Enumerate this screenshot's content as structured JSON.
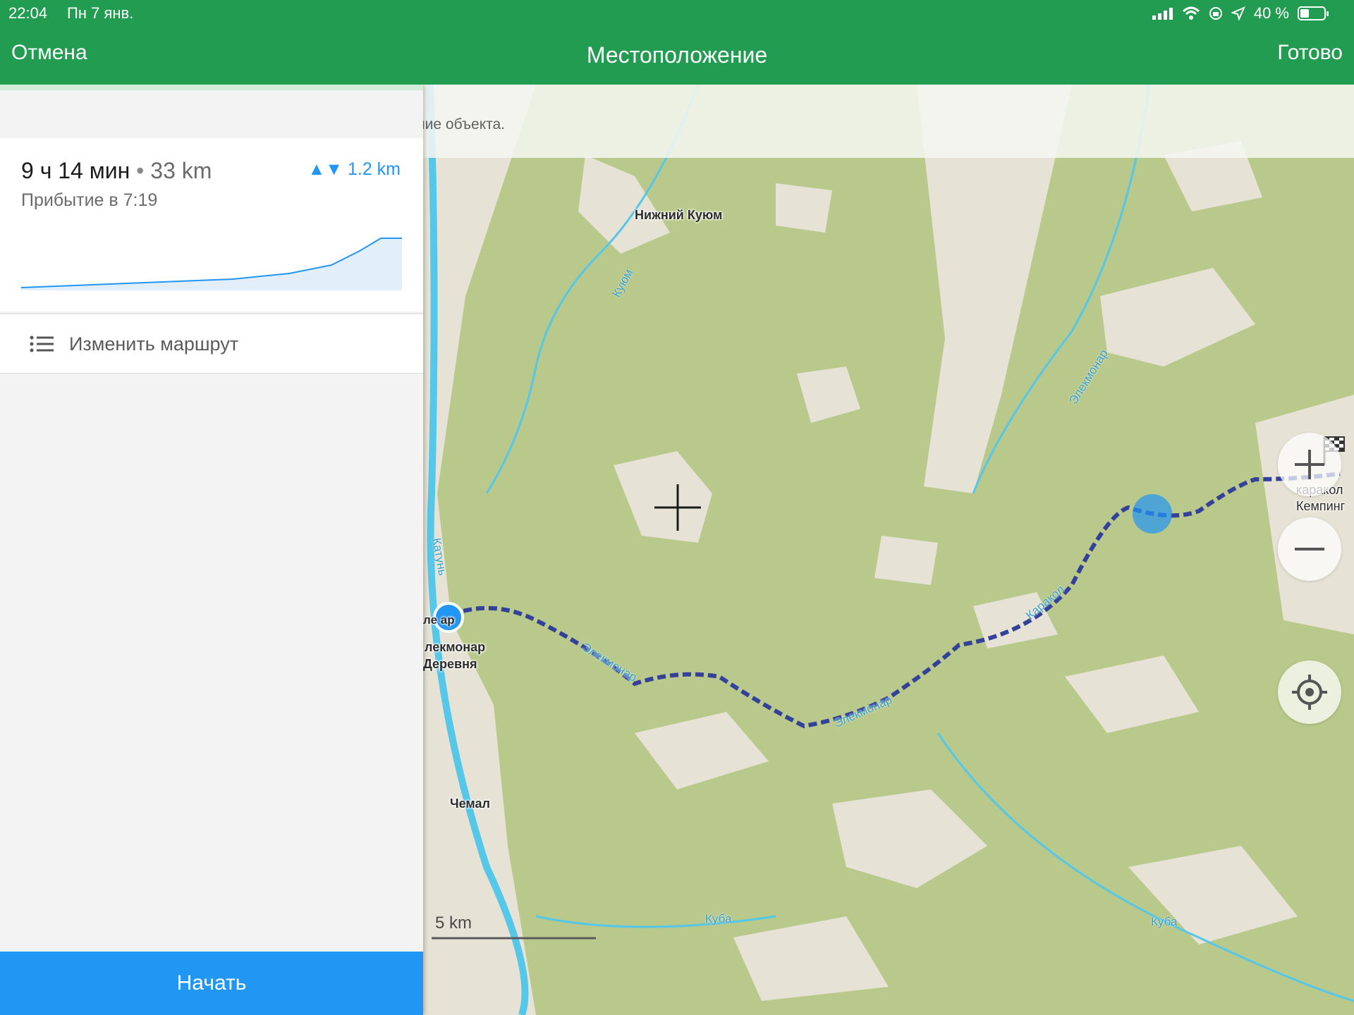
{
  "status_bar": {
    "time": "22:04",
    "date": "Пн 7 янв.",
    "battery": "40 %"
  },
  "nav": {
    "cancel": "Отмена",
    "title": "Местоположение",
    "done": "Готово"
  },
  "hint": "Потяните карту, чтобы выбрать правильное местоположение объекта.",
  "route": {
    "duration": "9 ч 14 мин",
    "separator": "•",
    "distance": "33 km",
    "elevation": "1.2 km",
    "arrival": "Прибытие в 7:19",
    "edit_label": "Изменить маршрут"
  },
  "start_button": "Начать",
  "map": {
    "scale": "5 km",
    "labels": {
      "nizhny_kuyum": "Нижний Куюм",
      "kuyum_river": "Куюм",
      "elekmonar_river_1": "Элекмонар",
      "elekmonar_river_2": "Элекмонар",
      "elekmonar_river_3": "Элекмонар",
      "karakol_river": "Каракол",
      "katun": "Катунь",
      "elekmonar_short": "ле      ар",
      "elekmonar_town": "лекмонар",
      "derevnya": "Деревня",
      "chemal": "Чемал",
      "kuba_1": "Куба",
      "kuba_2": "Куба",
      "karakol": "каракол",
      "kemping": "Кемпинг"
    },
    "colors": {
      "forest": "#b9c98b",
      "clearing": "#e6e3d6",
      "route": "#34419a",
      "water": "#55c7e8",
      "location": "#2196f3"
    }
  }
}
